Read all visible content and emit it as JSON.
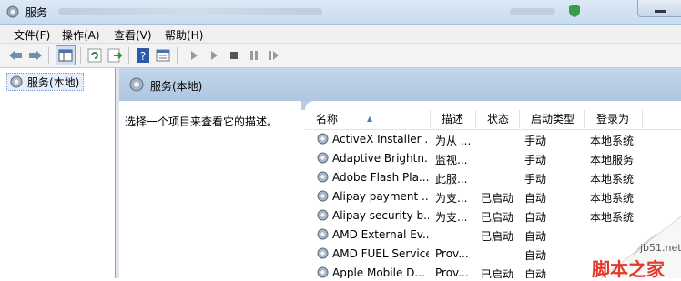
{
  "window": {
    "title": "服务"
  },
  "menu": {
    "items": [
      "文件(F)",
      "操作(A)",
      "查看(V)",
      "帮助(H)"
    ]
  },
  "tree": {
    "root_label": "服务(本地)"
  },
  "pane": {
    "header": "服务(本地)",
    "description_prompt": "选择一个项目来查看它的描述。"
  },
  "table": {
    "columns": [
      "名称",
      "描述",
      "状态",
      "启动类型",
      "登录为"
    ],
    "rows": [
      {
        "name": "ActiveX Installer ...",
        "desc": "为从 ...",
        "status": "",
        "startup": "手动",
        "logon": "本地系统"
      },
      {
        "name": "Adaptive Brightn...",
        "desc": "监视...",
        "status": "",
        "startup": "手动",
        "logon": "本地服务"
      },
      {
        "name": "Adobe Flash Pla...",
        "desc": "此服...",
        "status": "",
        "startup": "手动",
        "logon": "本地系统"
      },
      {
        "name": "Alipay payment ...",
        "desc": "为支...",
        "status": "已启动",
        "startup": "自动",
        "logon": "本地系统"
      },
      {
        "name": "Alipay security b...",
        "desc": "为支...",
        "status": "已启动",
        "startup": "自动",
        "logon": "本地系统"
      },
      {
        "name": "AMD External Ev...",
        "desc": "",
        "status": "已启动",
        "startup": "自动",
        "logon": ""
      },
      {
        "name": "AMD FUEL Service",
        "desc": "Prov...",
        "status": "",
        "startup": "自动",
        "logon": ""
      },
      {
        "name": "Apple Mobile D...",
        "desc": "Prov...",
        "status": "已启动",
        "startup": "自动",
        "logon": ""
      }
    ]
  },
  "watermark": {
    "url": "jb51.net",
    "text": "脚本之家"
  },
  "colors": {
    "header_blue": "#aec6e0",
    "watermark_red": "#e23a2a"
  }
}
